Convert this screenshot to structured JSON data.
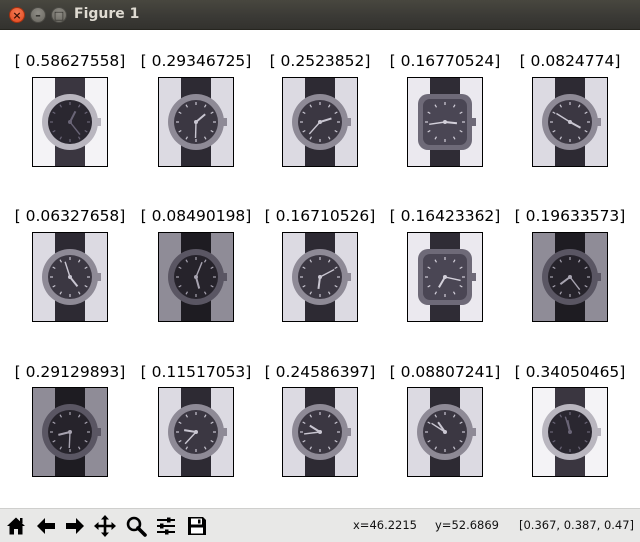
{
  "window": {
    "title": "Figure 1",
    "close_glyph": "×",
    "minimize_glyph": "–",
    "maximize_glyph": "□"
  },
  "figure": {
    "subplots": [
      {
        "label": "[ 0.58627558]",
        "style": "light"
      },
      {
        "label": "[ 0.29346725]",
        "style": "mid"
      },
      {
        "label": "[ 0.2523852]",
        "style": "mid"
      },
      {
        "label": "[ 0.16770524]",
        "style": "square"
      },
      {
        "label": "[ 0.0824774]",
        "style": "mid"
      },
      {
        "label": "[ 0.06327658]",
        "style": "mid"
      },
      {
        "label": "[ 0.08490198]",
        "style": "dark"
      },
      {
        "label": "[ 0.16710526]",
        "style": "mid"
      },
      {
        "label": "[ 0.16423362]",
        "style": "square"
      },
      {
        "label": "[ 0.19633573]",
        "style": "dark"
      },
      {
        "label": "[ 0.29129893]",
        "style": "dark"
      },
      {
        "label": "[ 0.11517053]",
        "style": "mid"
      },
      {
        "label": "[ 0.24586397]",
        "style": "mid"
      },
      {
        "label": "[ 0.08807241]",
        "style": "mid"
      },
      {
        "label": "[ 0.34050465]",
        "style": "light"
      }
    ]
  },
  "toolbar": {
    "buttons": [
      "home-icon",
      "back-icon",
      "forward-icon",
      "pan-icon",
      "zoom-icon",
      "configure-subplots-icon",
      "save-icon"
    ],
    "x_readout": "x=46.2215",
    "y_readout": "y=52.6869",
    "pixel_readout": "[0.367, 0.387, 0.47]"
  },
  "colors": {
    "titlebar": "#3a3935",
    "title_text": "#dfdbd2",
    "close_button": "#e1461c",
    "toolbar_bg": "#e8e8e7"
  }
}
